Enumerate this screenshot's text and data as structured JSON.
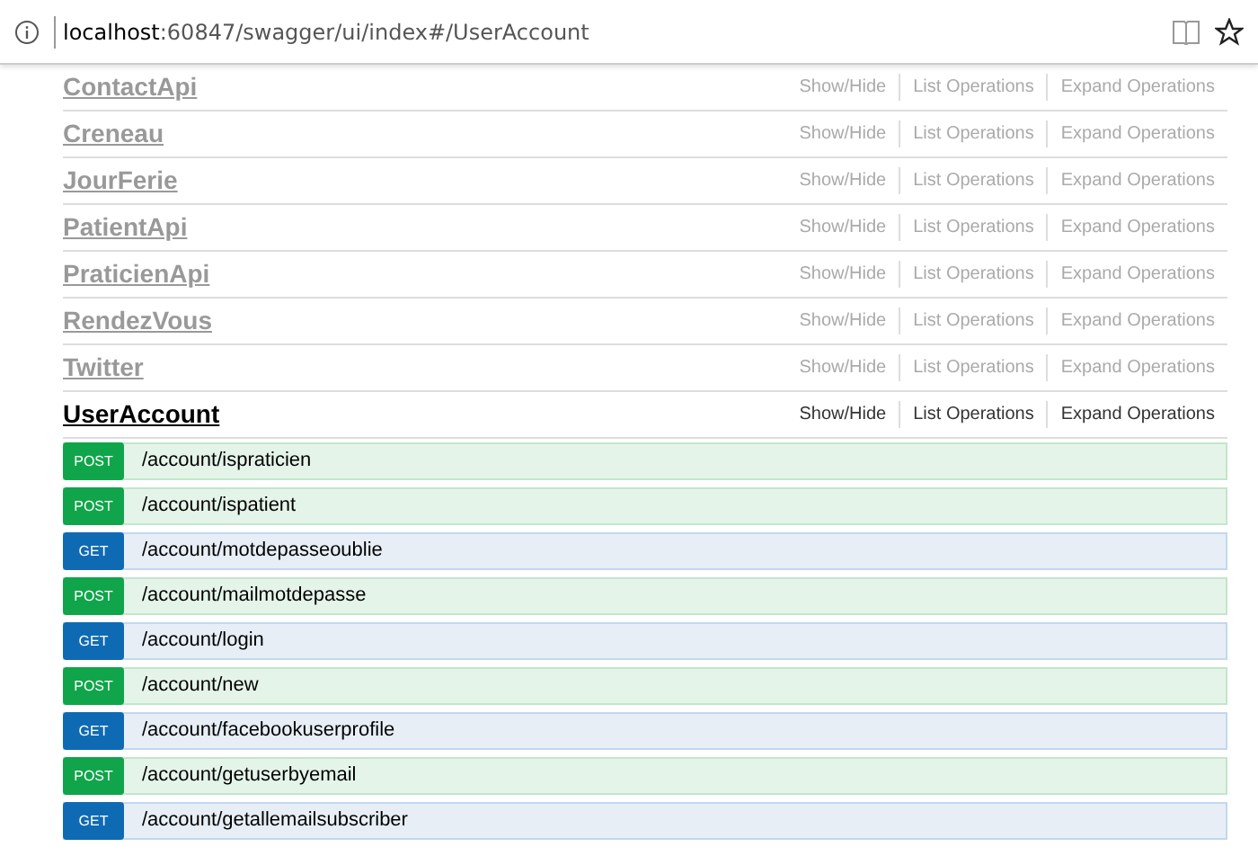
{
  "address_bar": {
    "host": "localhost",
    "path": ":60847/swagger/ui/index#/UserAccount"
  },
  "sections": [
    {
      "name": "ContactApi",
      "active": false,
      "links": [
        "Show/Hide",
        "List Operations",
        "Expand Operations"
      ]
    },
    {
      "name": "Creneau",
      "active": false,
      "links": [
        "Show/Hide",
        "List Operations",
        "Expand Operations"
      ]
    },
    {
      "name": "JourFerie",
      "active": false,
      "links": [
        "Show/Hide",
        "List Operations",
        "Expand Operations"
      ]
    },
    {
      "name": "PatientApi",
      "active": false,
      "links": [
        "Show/Hide",
        "List Operations",
        "Expand Operations"
      ]
    },
    {
      "name": "PraticienApi",
      "active": false,
      "links": [
        "Show/Hide",
        "List Operations",
        "Expand Operations"
      ]
    },
    {
      "name": "RendezVous",
      "active": false,
      "links": [
        "Show/Hide",
        "List Operations",
        "Expand Operations"
      ]
    },
    {
      "name": "Twitter",
      "active": false,
      "links": [
        "Show/Hide",
        "List Operations",
        "Expand Operations"
      ]
    },
    {
      "name": "UserAccount",
      "active": true,
      "links": [
        "Show/Hide",
        "List Operations",
        "Expand Operations"
      ]
    }
  ],
  "operations": [
    {
      "method": "POST",
      "path": "/account/ispraticien"
    },
    {
      "method": "POST",
      "path": "/account/ispatient"
    },
    {
      "method": "GET",
      "path": "/account/motdepasseoublie"
    },
    {
      "method": "POST",
      "path": "/account/mailmotdepasse"
    },
    {
      "method": "GET",
      "path": "/account/login"
    },
    {
      "method": "POST",
      "path": "/account/new"
    },
    {
      "method": "GET",
      "path": "/account/facebookuserprofile"
    },
    {
      "method": "POST",
      "path": "/account/getuserbyemail"
    },
    {
      "method": "GET",
      "path": "/account/getallemailsubscriber"
    }
  ]
}
